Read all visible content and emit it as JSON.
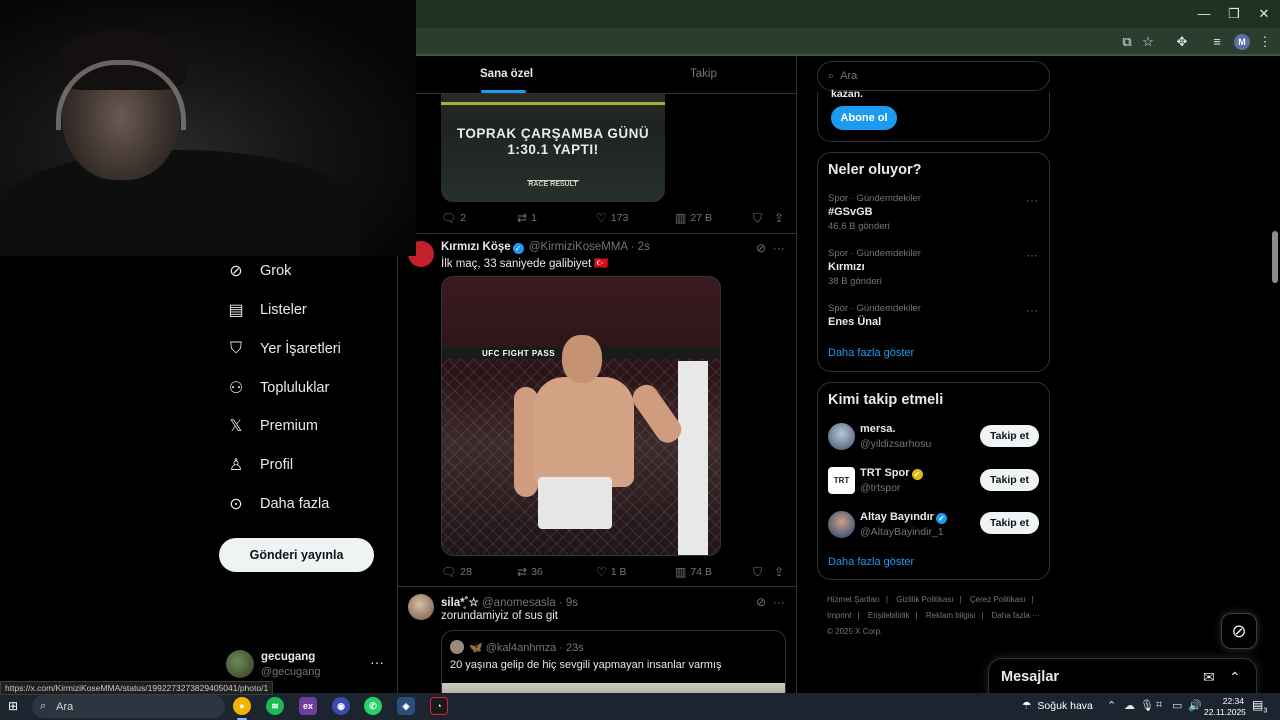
{
  "browser": {
    "window_controls": [
      "—",
      "❐",
      "✕"
    ],
    "profile_initial": "M"
  },
  "left_nav": {
    "items": [
      {
        "label": "Grok",
        "icon": "grok-icon",
        "glyph": "⊘"
      },
      {
        "label": "Listeler",
        "icon": "list-icon",
        "glyph": "▤"
      },
      {
        "label": "Yer İşaretleri",
        "icon": "bookmark-icon",
        "glyph": "⛉"
      },
      {
        "label": "Topluluklar",
        "icon": "communities-icon",
        "glyph": "⚇"
      },
      {
        "label": "Premium",
        "icon": "x-logo-icon",
        "glyph": "𝕏"
      },
      {
        "label": "Profil",
        "icon": "profile-icon",
        "glyph": "♙"
      },
      {
        "label": "Daha fazla",
        "icon": "more-circle-icon",
        "glyph": "⊙"
      }
    ],
    "post_button": "Gönderi yayınla",
    "account": {
      "name": "gecugang",
      "handle": "@gecugang",
      "more": "···"
    }
  },
  "feed": {
    "tabs": [
      {
        "label": "Sana özel",
        "active": true
      },
      {
        "label": "Takip",
        "active": false
      }
    ],
    "promo": {
      "text_line1": "TOPRAK ÇARŞAMBA GÜNÜ",
      "text_line2": "1:30.1 YAPTI!",
      "logo": "RACE RESULT"
    },
    "promo_actions": {
      "replies": "2",
      "reposts": "1",
      "likes": "173",
      "views": "27 B"
    },
    "tweet1": {
      "name": "Kırmızı Köşe",
      "handle": "@KirmiziKoseMMA",
      "time": "· 2s",
      "text": "İlk maç, 33 saniyede galibiyet 🇹🇷",
      "image_brand": "UFC FIGHT PASS",
      "actions": {
        "replies": "28",
        "reposts": "36",
        "likes": "1 B",
        "views": "74 B"
      }
    },
    "tweet2": {
      "name": "sila*̥˚☆",
      "handle": "@anomesasla",
      "time": "· 9s",
      "text": "zorundamiyiz of sus git",
      "quote": {
        "name": "🦋",
        "handle": "@kal4anhmza",
        "time": "· 23s",
        "text": "20 yaşına gelip de hiç sevgili yapmayan insanlar varmış"
      }
    }
  },
  "right_col": {
    "search_placeholder": "Ara",
    "premium_card": {
      "cut_text": "kazan.",
      "button": "Abone ol"
    },
    "trends": {
      "title": "Neler oluyor?",
      "items": [
        {
          "category": "Spor · Gündemdekiler",
          "name": "#GSvGB",
          "count": "46,6 B gönderi"
        },
        {
          "category": "Spor · Gündemdekiler",
          "name": "Kırmızı",
          "count": "38 B gönderi"
        },
        {
          "category": "Spor · Gündemdekiler",
          "name": "Enes Ünal",
          "count": ""
        }
      ],
      "more": "Daha fazla göster"
    },
    "who_to_follow": {
      "title": "Kimi takip etmeli",
      "items": [
        {
          "name": "mersa.",
          "handle": "@yildizsarhosu",
          "button": "Takip et",
          "verified": ""
        },
        {
          "name": "TRT Spor",
          "handle": "@trtspor",
          "button": "Takip et",
          "verified": "gold"
        },
        {
          "name": "Altay Bayındır",
          "handle": "@AltayBayindir_1",
          "button": "Takip et",
          "verified": "blue"
        }
      ],
      "more": "Daha fazla göster"
    },
    "footer": {
      "links": [
        "Hizmet Şartları",
        "|",
        "Gizlilik Politikası",
        "|",
        "Çerez Politikası",
        "|",
        "Imprint",
        "|",
        "Erişilebilirlik",
        "|",
        "Reklam bilgisi",
        "|",
        "Daha fazla ···"
      ],
      "copyright": "© 2025 X Corp."
    }
  },
  "messages": {
    "title": "Mesajlar"
  },
  "status_url": "https://x.com/KirmiziKoseMMA/status/1992273273829405041/photo/1",
  "taskbar": {
    "search": "Ara",
    "weather": "Soğuk hava",
    "time": "22:34",
    "date": "22.11.2025",
    "notifications": "3"
  },
  "colors": {
    "accent": "#1d9bf0",
    "background": "#000000",
    "muted": "#71767b",
    "chrome": "#1f3323"
  }
}
